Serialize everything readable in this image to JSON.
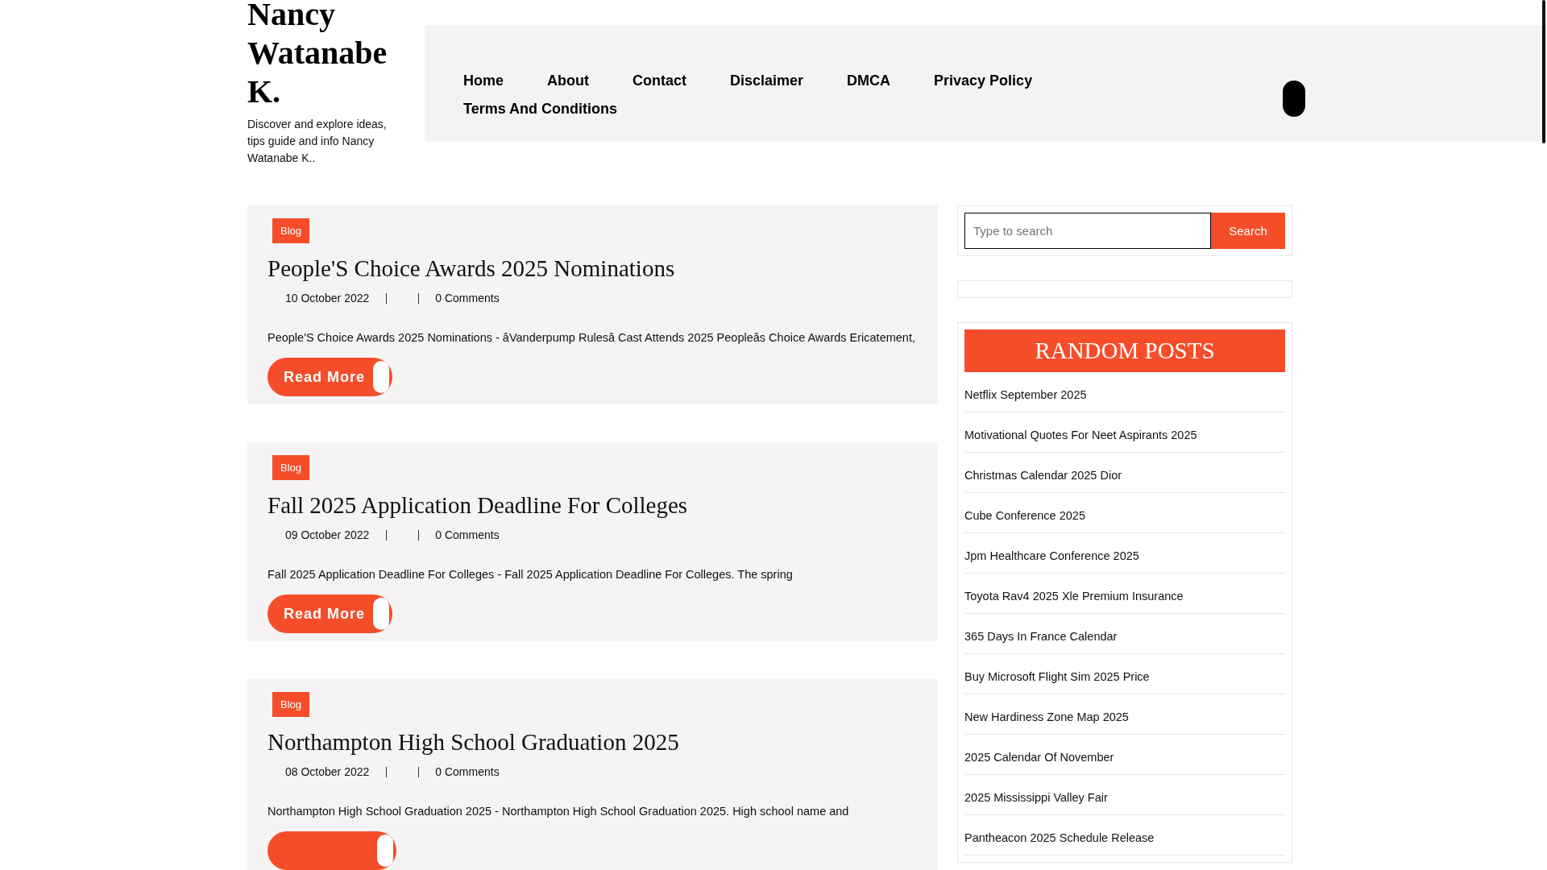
{
  "site": {
    "title": "Nancy Watanabe K.",
    "tagline": "Discover and explore ideas, tips guide and info Nancy Watanabe K.."
  },
  "nav": [
    {
      "label": "Home"
    },
    {
      "label": "About"
    },
    {
      "label": "Contact"
    },
    {
      "label": "Disclaimer"
    },
    {
      "label": "DMCA"
    },
    {
      "label": "Privacy Policy"
    },
    {
      "label": "Terms And Conditions"
    }
  ],
  "posts": [
    {
      "category": "Blog",
      "title": "People'S Choice Awards 2025 Nominations",
      "date": "10 October 2022",
      "comments": "0 Comments",
      "excerpt": "People'S Choice Awards 2025 Nominations - âVanderpump Rulesâ Cast Attends 2025 Peopleâs Choice Awards Ericatement,",
      "read_more": "Read More"
    },
    {
      "category": "Blog",
      "title": "Fall 2025 Application Deadline For Colleges",
      "date": "09 October 2022",
      "comments": "0 Comments",
      "excerpt": "Fall 2025 Application Deadline For Colleges - Fall 2025 Application Deadline For Colleges. The spring",
      "read_more": "Read More"
    },
    {
      "category": "Blog",
      "title": "Northampton High School Graduation 2025",
      "date": "08 October 2022",
      "comments": "0 Comments",
      "excerpt": "Northampton High School Graduation 2025 - Northampton High School Graduation 2025. High school name and"
    }
  ],
  "search": {
    "placeholder": "Type to search",
    "button": "Search"
  },
  "random_posts": {
    "title": "RANDOM POSTS",
    "items": [
      "Netflix September 2025",
      "Motivational Quotes For Neet Aspirants 2025",
      "Christmas Calendar 2025 Dior",
      "Cube Conference 2025",
      "Jpm Healthcare Conference 2025",
      "Toyota Rav4 2025 Xle Premium Insurance",
      "365 Days In France Calendar",
      "Buy Microsoft Flight Sim 2025 Price",
      "New Hardiness Zone Map 2025",
      "2025 Calendar Of November",
      "2025 Mississippi Valley Fair",
      "Pantheacon 2025 Schedule Release"
    ]
  }
}
